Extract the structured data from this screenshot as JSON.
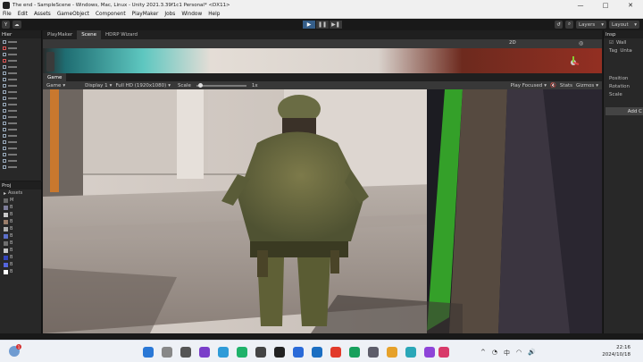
{
  "window": {
    "title": "The end - SampleScene - Windows, Mac, Linux - Unity 2021.3.39f1c1 Personal* <DX11>",
    "controls": [
      "—",
      "□",
      "✕"
    ]
  },
  "menu": [
    "File",
    "Edit",
    "Assets",
    "GameObject",
    "Component",
    "PlayMaker",
    "Jobs",
    "Window",
    "Help"
  ],
  "toolbar": {
    "account_label": "Y",
    "play_buttons": [
      "▶",
      "❚❚",
      "▶❚"
    ],
    "layers_label": "Layers",
    "layout_label": "Layout"
  },
  "hierarchy": {
    "tab_label": "Hier"
  },
  "project": {
    "tab_label": "Proj",
    "assets_label": "Assets",
    "items": [
      {
        "label": "M",
        "color": "#6a6a6a"
      },
      {
        "label": "B",
        "color": "#7d7d9a"
      },
      {
        "label": "B",
        "color": "#c8c8c8"
      },
      {
        "label": "B",
        "color": "#9a7d6a"
      },
      {
        "label": "B",
        "color": "#b0b0b0"
      },
      {
        "label": "B",
        "color": "#5c6fc9"
      },
      {
        "label": "B",
        "color": "#6f6f6f"
      },
      {
        "label": "B",
        "color": "#c8c8c8"
      },
      {
        "label": "B",
        "color": "#3344bb"
      },
      {
        "label": "B",
        "color": "#5566dd"
      },
      {
        "label": "B",
        "color": "#ffffff"
      }
    ]
  },
  "scene_tabs": [
    "PlayMaker",
    "Scene",
    "HDRP Wizard"
  ],
  "scene_toolbar": {
    "mode_2d": "2D"
  },
  "game": {
    "tab_label": "Game",
    "mode": "Game",
    "display": "Display 1",
    "resolution": "Full HD (1920x1080)",
    "scale_label": "Scale",
    "scale_value": "1x",
    "play_focused": "Play Focused",
    "stats": "Stats",
    "gizmos": "Gizmos"
  },
  "inspector": {
    "tab_label": "Insp",
    "object_name": "Wall",
    "tag_label": "Tag",
    "tag_value": "Untagged",
    "position_label": "Position",
    "rotation_label": "Rotation",
    "scale_label": "Scale",
    "add_component": "Add C"
  },
  "taskbar": {
    "notification_count": "1",
    "time": "22:16",
    "date": "2024/10/18",
    "tray_lang": "中",
    "tray_icons": [
      "^",
      "◔",
      "🔊"
    ]
  }
}
